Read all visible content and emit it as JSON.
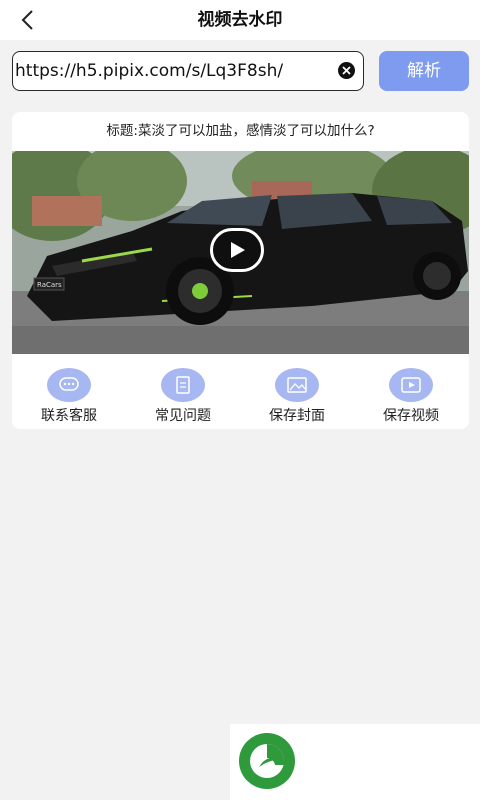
{
  "header": {
    "title": "视频去水印"
  },
  "url_input": {
    "value": "https://h5.pipix.com/s/Lq3F8sh/"
  },
  "parse_button": {
    "label": "解析"
  },
  "video": {
    "title": "标题:菜淡了可以加盐，感情淡了可以加什么?",
    "plate_text": "RaCars"
  },
  "actions": [
    {
      "label": "联系客服",
      "icon": "chat-icon"
    },
    {
      "label": "常见问题",
      "icon": "document-icon"
    },
    {
      "label": "保存封面",
      "icon": "image-icon"
    },
    {
      "label": "保存视频",
      "icon": "video-icon"
    }
  ],
  "colors": {
    "accent": "#7e9bf0",
    "icon_circle": "#a7b7f1",
    "brand_green": "#2e9a3c"
  }
}
